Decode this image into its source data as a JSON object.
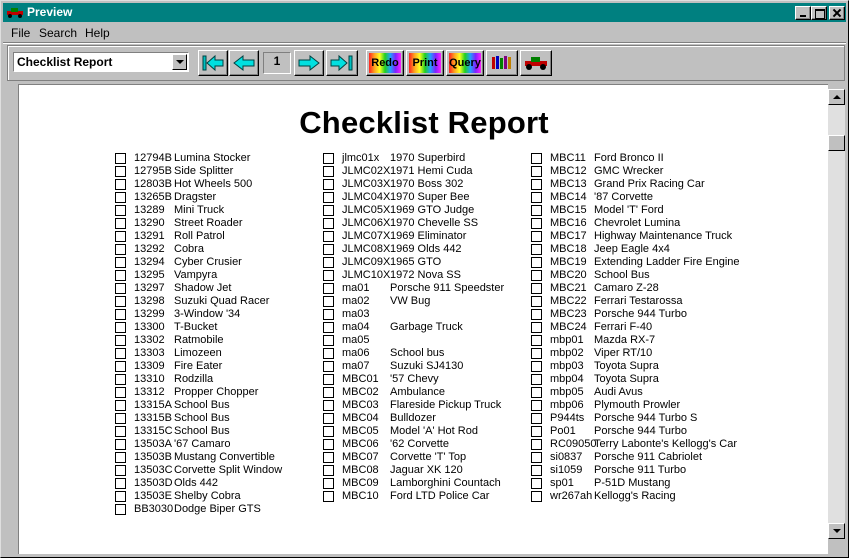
{
  "window": {
    "title": "Preview"
  },
  "menu": [
    "File",
    "Search",
    "Help"
  ],
  "toolbar": {
    "report_select": "Checklist Report",
    "page_number": "1",
    "redo_label": "Redo",
    "print_label": "Print",
    "query_label": "Query"
  },
  "report": {
    "title": "Checklist Report",
    "columns": [
      [
        [
          "12794B",
          "Lumina Stocker"
        ],
        [
          "12795B",
          "Side Splitter"
        ],
        [
          "12803B",
          "Hot Wheels 500"
        ],
        [
          "13265B",
          "Dragster"
        ],
        [
          "13289",
          "Mini Truck"
        ],
        [
          "13290",
          "Street Roader"
        ],
        [
          "13291",
          "Roll Patrol"
        ],
        [
          "13292",
          "Cobra"
        ],
        [
          "13294",
          "Cyber Crusier"
        ],
        [
          "13295",
          "Vampyra"
        ],
        [
          "13297",
          "Shadow Jet"
        ],
        [
          "13298",
          "Suzuki Quad Racer"
        ],
        [
          "13299",
          "3-Window '34"
        ],
        [
          "13300",
          "T-Bucket"
        ],
        [
          "13302",
          "Ratmobile"
        ],
        [
          "13303",
          "Limozeen"
        ],
        [
          "13309",
          "Fire Eater"
        ],
        [
          "13310",
          "Rodzilla"
        ],
        [
          "13312",
          "Propper Chopper"
        ],
        [
          "13315A",
          "School Bus"
        ],
        [
          "13315B",
          "School Bus"
        ],
        [
          "13315C",
          "School Bus"
        ],
        [
          "13503A",
          "'67 Camaro"
        ],
        [
          "13503B",
          "Mustang Convertible"
        ],
        [
          "13503C",
          "Corvette Split Window"
        ],
        [
          "13503D",
          "Olds 442"
        ],
        [
          "13503E",
          "Shelby Cobra"
        ],
        [
          "BB3030",
          "Dodge Biper GTS"
        ]
      ],
      [
        [
          "jlmc01x",
          "1970 Superbird"
        ],
        [
          "JLMC02X",
          "1971 Hemi Cuda"
        ],
        [
          "JLMC03X",
          "1970 Boss 302"
        ],
        [
          "JLMC04X",
          "1970 Super Bee"
        ],
        [
          "JLMC05X",
          "1969 GTO Judge"
        ],
        [
          "JLMC06X",
          "1970 Chevelle SS"
        ],
        [
          "JLMC07X",
          "1969 Eliminator"
        ],
        [
          "JLMC08X",
          "1969 Olds 442"
        ],
        [
          "JLMC09X",
          "1965 GTO"
        ],
        [
          "JLMC10X",
          "1972 Nova SS"
        ],
        [
          "ma01",
          "Porsche 911 Speedster"
        ],
        [
          "ma02",
          "VW Bug"
        ],
        [
          "ma03",
          ""
        ],
        [
          "ma04",
          "Garbage Truck"
        ],
        [
          "ma05",
          ""
        ],
        [
          "ma06",
          "School bus"
        ],
        [
          "ma07",
          "Suzuki SJ4130"
        ],
        [
          "MBC01",
          "'57 Chevy"
        ],
        [
          "MBC02",
          "Ambulance"
        ],
        [
          "MBC03",
          "Flareside Pickup Truck"
        ],
        [
          "MBC04",
          "Bulldozer"
        ],
        [
          "MBC05",
          "Model 'A' Hot Rod"
        ],
        [
          "MBC06",
          "'62 Corvette"
        ],
        [
          "MBC07",
          "Corvette 'T' Top"
        ],
        [
          "MBC08",
          "Jaguar XK 120"
        ],
        [
          "MBC09",
          "Lamborghini Countach"
        ],
        [
          "MBC10",
          "Ford LTD Police Car"
        ]
      ],
      [
        [
          "MBC11",
          "Ford Bronco II"
        ],
        [
          "MBC12",
          "GMC Wrecker"
        ],
        [
          "MBC13",
          "Grand Prix Racing Car"
        ],
        [
          "MBC14",
          "'87 Corvette"
        ],
        [
          "MBC15",
          "Model 'T' Ford"
        ],
        [
          "MBC16",
          "Chevrolet Lumina"
        ],
        [
          "MBC17",
          "Highway Maintenance Truck"
        ],
        [
          "MBC18",
          "Jeep Eagle 4x4"
        ],
        [
          "MBC19",
          "Extending Ladder Fire Engine"
        ],
        [
          "MBC20",
          "School Bus"
        ],
        [
          "MBC21",
          "Camaro Z-28"
        ],
        [
          "MBC22",
          "Ferrari Testarossa"
        ],
        [
          "MBC23",
          "Porsche 944 Turbo"
        ],
        [
          "MBC24",
          "Ferrari F-40"
        ],
        [
          "mbp01",
          "Mazda RX-7"
        ],
        [
          "mbp02",
          "Viper RT/10"
        ],
        [
          "mbp03",
          "Toyota Supra"
        ],
        [
          "mbp04",
          "Toyota Supra"
        ],
        [
          "mbp05",
          "Audi Avus"
        ],
        [
          "mbp06",
          "Plymouth Prowler"
        ],
        [
          "P944ts",
          "Porsche 944 Turbo S"
        ],
        [
          "Po01",
          "Porsche 944 Turbo"
        ],
        [
          "RC09050",
          "Terry Labonte's Kellogg's Car"
        ],
        [
          "si0837",
          "Porsche 911 Cabriolet"
        ],
        [
          "si1059",
          "Porsche 911 Turbo"
        ],
        [
          "sp01",
          "P-51D Mustang"
        ],
        [
          "wr267ah",
          "Kellogg's Racing"
        ]
      ]
    ]
  }
}
